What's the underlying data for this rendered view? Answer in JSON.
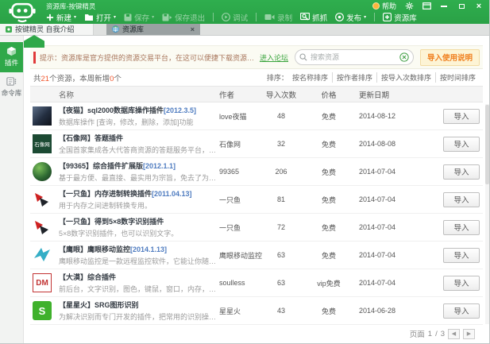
{
  "colors": {
    "brand_green": "#2fa849",
    "accent_orange": "#f07f1e",
    "count_red": "#f0562d",
    "link_green": "#39a43c",
    "active_tab_gray": "#9aa1a2"
  },
  "glyphs": {
    "dropdown": "▾",
    "close": "×",
    "prev": "◀",
    "next": "▶"
  },
  "titlebar": {
    "title": "资源库-按键精灵",
    "help_label": "帮助"
  },
  "toolbar": {
    "items": [
      {
        "label": "新建",
        "dropdown": true,
        "enabled": true
      },
      {
        "label": "打开",
        "dropdown": true,
        "enabled": true
      },
      {
        "label": "保存",
        "dropdown": true,
        "enabled": false
      },
      {
        "label": "保存退出",
        "dropdown": false,
        "enabled": false
      },
      {
        "label": "调试",
        "dropdown": false,
        "enabled": false
      },
      {
        "label": "录制",
        "dropdown": false,
        "enabled": false
      },
      {
        "label": "抓抓",
        "dropdown": false,
        "enabled": true
      },
      {
        "label": "发布",
        "dropdown": true,
        "enabled": true
      },
      {
        "label": "资源库",
        "dropdown": false,
        "enabled": true
      }
    ]
  },
  "tabs": [
    {
      "label": "按键精灵 自我介绍",
      "active": false
    },
    {
      "label": "资源库",
      "active": true
    }
  ],
  "sidebar": {
    "items": [
      {
        "label": "插件",
        "active": true
      },
      {
        "label": "命令库",
        "active": false
      }
    ]
  },
  "notice": {
    "text": "提示：资源库是官方提供的资源交易平台，在这可以便捷下载资源。更多资源可以到按键精灵论坛下载。",
    "link": "进入论坛"
  },
  "search": {
    "placeholder": "搜索资源"
  },
  "import_help_button": "导入使用说明",
  "stats": {
    "before": "共",
    "count": "21",
    "middle": "个资源，本周新增",
    "added": "0",
    "after": "个"
  },
  "sort": {
    "label": "排序：",
    "options": [
      "按名称排序",
      "按作者排序",
      "按导入次数排序",
      "按时间排序"
    ]
  },
  "table": {
    "headers": {
      "name": "名称",
      "author": "作者",
      "imports": "导入次数",
      "price": "价格",
      "date": "更新日期"
    },
    "import_button": "导入",
    "rows": [
      {
        "title": "【夜猫】sql2000数据库操作插件",
        "version": "[2012.3.5]",
        "desc": "数据库操作 [查询，修改，删除，添加]功能",
        "author": "love夜猫",
        "imports": "48",
        "price": "免费",
        "date": "2014-08-12",
        "icon_text": ""
      },
      {
        "title": "【石像网】答题插件",
        "version": "",
        "desc": "全国首家集成各大代答商资源的答题服务平台，最稳定、最效率、性",
        "author": "石像网",
        "imports": "32",
        "price": "免费",
        "date": "2014-08-08",
        "icon_text": "石像网"
      },
      {
        "title": "【99365】综合插件扩展版",
        "version": "[2012.1.1]",
        "desc": "基于最方便、最直接、最实用为宗旨，免去了为实现一个功能而去寻",
        "author": "99365",
        "imports": "206",
        "price": "免费",
        "date": "2014-07-04",
        "icon_text": ""
      },
      {
        "title": "【一只鱼】内存进制转换插件",
        "version": "[2011.04.13]",
        "desc": "用于内存之间进制转换专用。",
        "author": "一只鱼",
        "imports": "81",
        "price": "免费",
        "date": "2014-07-04",
        "icon_text": ""
      },
      {
        "title": "【一只鱼】得到5×8数字识别插件",
        "version": "",
        "desc": "5×8数字识别插件，也可以识别文字。",
        "author": "一只鱼",
        "imports": "72",
        "price": "免费",
        "date": "2014-07-04",
        "icon_text": ""
      },
      {
        "title": "【鹰眼】鹰眼移动监控",
        "version": "[2014.1.13]",
        "desc": "鹰眼移动监控是一款远程监控软件，它能让你随时随地远程监控电",
        "author": "鹰眼移动监控",
        "imports": "63",
        "price": "免费",
        "date": "2014-07-04",
        "icon_text": ""
      },
      {
        "title": "【大漠】综合插件",
        "version": "",
        "desc": "前后台，文字识别，图色，键鼠，窗口，内存，DX，Call",
        "author": "soulless",
        "imports": "63",
        "price": "vip免费",
        "date": "2014-07-04",
        "icon_text": "DM"
      },
      {
        "title": "【星星火】SRG图形识别",
        "version": "",
        "desc": "为解决识别而专门开发的插件，把常用的识别操作进行分类和整理，",
        "author": "星星火",
        "imports": "43",
        "price": "免费",
        "date": "2014-06-28",
        "icon_text": "S"
      }
    ]
  },
  "pagination": {
    "label": "页面",
    "current": "1",
    "separator": "/",
    "total": "3"
  }
}
